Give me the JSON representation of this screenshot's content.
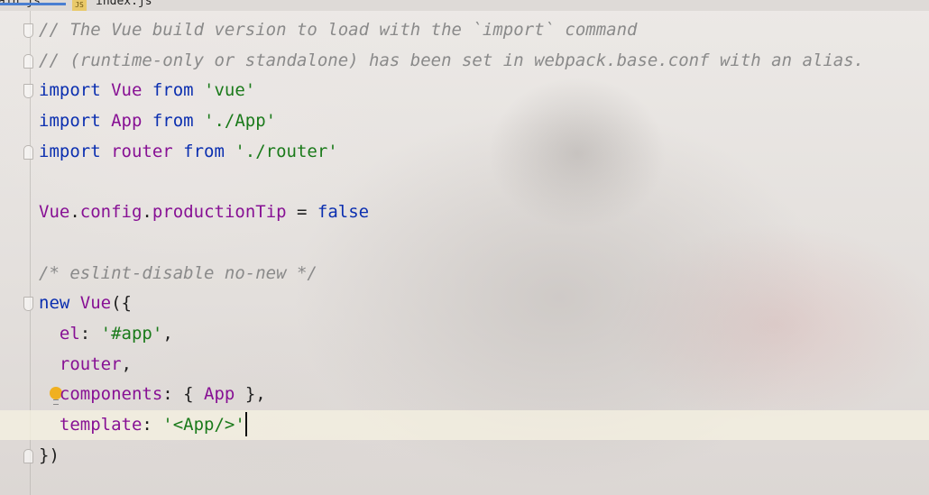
{
  "tabs": [
    {
      "label": "ain.js",
      "active": true
    },
    {
      "label": "index.js",
      "icon": "JS",
      "active": false
    }
  ],
  "colors": {
    "keyword": "#0b2fb0",
    "identifier": "#871094",
    "string": "#1a7a1a",
    "comment": "#8a8a8a",
    "current_line": "#f5f2e1",
    "intention_bulb": "#f0b020"
  },
  "editor": {
    "lines": [
      {
        "tokens": [
          {
            "t": "// The Vue build version to load with the `import` command",
            "k": "comment"
          }
        ]
      },
      {
        "tokens": [
          {
            "t": "// (runtime-only or standalone) has been set in webpack.base.conf with an alias.",
            "k": "comment"
          }
        ]
      },
      {
        "tokens": [
          {
            "t": "import",
            "k": "kw"
          },
          {
            "t": " Vue ",
            "k": "ident"
          },
          {
            "t": "from",
            "k": "kw"
          },
          {
            "t": " 'vue'",
            "k": "str"
          }
        ]
      },
      {
        "tokens": [
          {
            "t": "import",
            "k": "kw"
          },
          {
            "t": " App ",
            "k": "ident"
          },
          {
            "t": "from",
            "k": "kw"
          },
          {
            "t": " './App'",
            "k": "str"
          }
        ]
      },
      {
        "tokens": [
          {
            "t": "import",
            "k": "kw"
          },
          {
            "t": " router ",
            "k": "ident"
          },
          {
            "t": "from",
            "k": "kw"
          },
          {
            "t": " './router'",
            "k": "str"
          }
        ]
      },
      {
        "tokens": []
      },
      {
        "tokens": [
          {
            "t": "Vue",
            "k": "ident"
          },
          {
            "t": ".",
            "k": "punc"
          },
          {
            "t": "config",
            "k": "ident"
          },
          {
            "t": ".",
            "k": "punc"
          },
          {
            "t": "productionTip",
            "k": "ident"
          },
          {
            "t": " = ",
            "k": "punc"
          },
          {
            "t": "false",
            "k": "kw"
          }
        ]
      },
      {
        "tokens": []
      },
      {
        "tokens": [
          {
            "t": "/* eslint-disable no-new */",
            "k": "comment"
          }
        ]
      },
      {
        "tokens": [
          {
            "t": "new",
            "k": "kw"
          },
          {
            "t": " ",
            "k": "punc"
          },
          {
            "t": "Vue",
            "k": "ident"
          },
          {
            "t": "({",
            "k": "punc"
          }
        ]
      },
      {
        "tokens": [
          {
            "t": "  ",
            "k": "punc"
          },
          {
            "t": "el",
            "k": "ident"
          },
          {
            "t": ": ",
            "k": "punc"
          },
          {
            "t": "'#app'",
            "k": "str"
          },
          {
            "t": ",",
            "k": "punc"
          }
        ]
      },
      {
        "tokens": [
          {
            "t": "  ",
            "k": "punc"
          },
          {
            "t": "router",
            "k": "ident"
          },
          {
            "t": ",",
            "k": "punc"
          }
        ]
      },
      {
        "tokens": [
          {
            "t": "  ",
            "k": "punc"
          },
          {
            "t": "components",
            "k": "ident"
          },
          {
            "t": ": { ",
            "k": "punc"
          },
          {
            "t": "App",
            "k": "ident"
          },
          {
            "t": " },",
            "k": "punc"
          }
        ]
      },
      {
        "tokens": [
          {
            "t": "  ",
            "k": "punc"
          },
          {
            "t": "template",
            "k": "ident"
          },
          {
            "t": ": ",
            "k": "punc"
          },
          {
            "t": "'<App/>'",
            "k": "str"
          }
        ]
      },
      {
        "tokens": [
          {
            "t": "})",
            "k": "punc"
          }
        ]
      }
    ]
  }
}
